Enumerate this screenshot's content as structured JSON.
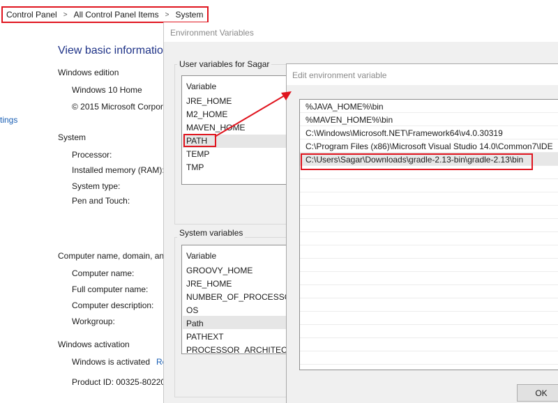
{
  "breadcrumb": [
    "Control Panel",
    "All Control Panel Items",
    "System"
  ],
  "system_page": {
    "heading": "View basic informatio",
    "left_link": "tings",
    "windows_edition": {
      "title": "Windows edition",
      "edition": "Windows 10 Home",
      "copyright": "© 2015 Microsoft Corpor"
    },
    "system": {
      "title": "System",
      "processor": "Processor:",
      "memory": "Installed memory (RAM):",
      "system_type": "System type:",
      "pen_touch": "Pen and Touch:"
    },
    "computer_name": {
      "title": "Computer name, domain, an",
      "computer_name": "Computer name:",
      "full_name": "Full computer name:",
      "description": "Computer description:",
      "workgroup": "Workgroup:"
    },
    "activation": {
      "title": "Windows activation",
      "status": "Windows is activated",
      "link": "Re",
      "product_id": "Product ID:  00325-80220-"
    }
  },
  "env_dialog": {
    "title": "Environment Variables",
    "user_group_label": "User variables for Sagar",
    "user_header": "Variable",
    "user_vars": [
      "JRE_HOME",
      "M2_HOME",
      "MAVEN_HOME",
      "PATH",
      "TEMP",
      "TMP"
    ],
    "system_group_label": "System variables",
    "system_header": "Variable",
    "system_vars": [
      "GROOVY_HOME",
      "JRE_HOME",
      "NUMBER_OF_PROCESSORS",
      "OS",
      "Path",
      "PATHEXT",
      "PROCESSOR_ARCHITECTU"
    ]
  },
  "edit_dialog": {
    "title": "Edit environment variable",
    "entries": [
      "%JAVA_HOME%\\bin",
      "%MAVEN_HOME%\\bin",
      "C:\\Windows\\Microsoft.NET\\Framework64\\v4.0.30319",
      "C:\\Program Files (x86)\\Microsoft Visual Studio 14.0\\Common7\\IDE",
      "C:\\Users\\Sagar\\Downloads\\gradle-2.13-bin\\gradle-2.13\\bin"
    ],
    "ok_label": "OK"
  },
  "colors": {
    "highlight": "#e0141e",
    "heading": "#1e3287",
    "link": "#1a5fb4",
    "dialog_bg": "#f0f0f0"
  }
}
